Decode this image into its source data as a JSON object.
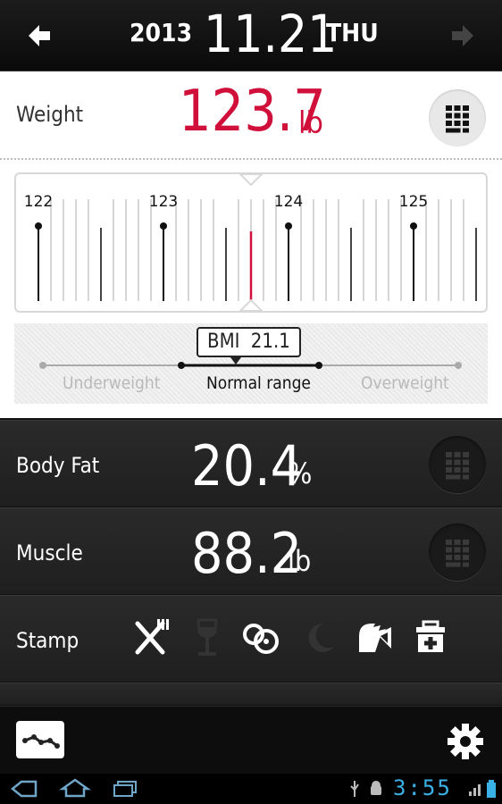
{
  "header": {
    "year": "2013",
    "date": "11.21",
    "day": "THU",
    "prev_icon": "arrow-left-icon",
    "next_icon": "arrow-right-icon"
  },
  "weight": {
    "label": "Weight",
    "value": "123.7",
    "unit": "lb",
    "keypad_icon": "keypad-icon"
  },
  "ruler": {
    "tick_labels": [
      "122",
      "123",
      "124",
      "125"
    ],
    "current_value": 123.7
  },
  "bmi": {
    "label": "BMI",
    "value": "21.1",
    "categories": [
      "Underweight",
      "Normal range",
      "Overweight"
    ],
    "active_category": "Normal range"
  },
  "body_fat": {
    "label": "Body Fat",
    "value": "20.4",
    "unit": "%"
  },
  "muscle": {
    "label": "Muscle",
    "value": "88.2",
    "unit": "lb"
  },
  "stamp": {
    "label": "Stamp",
    "icons": [
      "fork-knife-icon",
      "wine-glass-icon",
      "dumbbell-icon",
      "moon-icon",
      "shout-icon",
      "first-aid-kit-icon"
    ]
  },
  "footer": {
    "graph_icon": "graph-icon",
    "settings_icon": "gear-icon"
  },
  "sysbar": {
    "time": "3:55"
  },
  "colors": {
    "accent": "#d0103a",
    "system": "#3ab2e8"
  }
}
